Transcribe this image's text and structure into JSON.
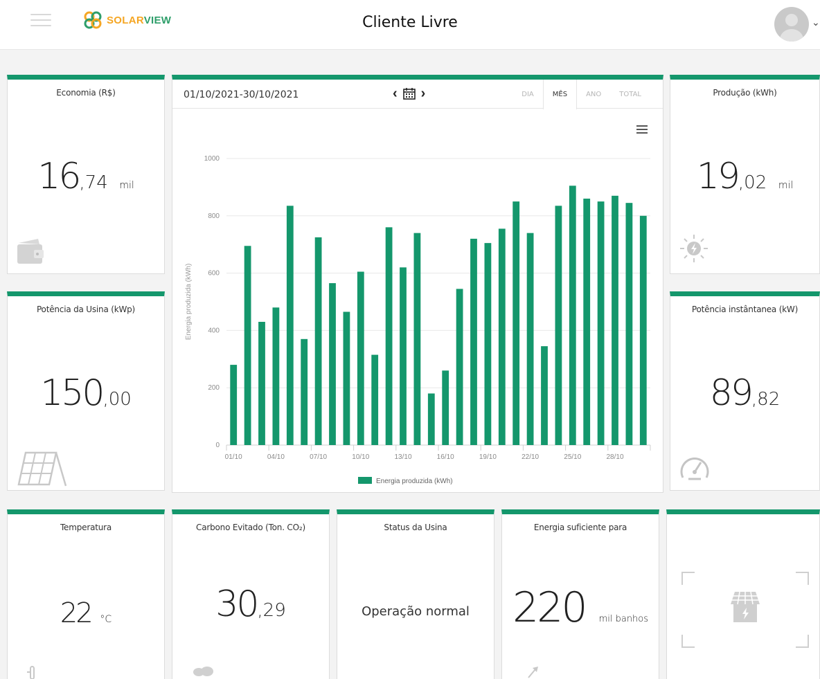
{
  "header": {
    "brand_solar": "SOLAR",
    "brand_view": "VIEW",
    "title": "Cliente Livre"
  },
  "cards": {
    "economia": {
      "title": "Economia (R$)",
      "integer": "16",
      "decimal": ",74",
      "unit": "mil",
      "icon": "wallet-icon"
    },
    "potencia_usina": {
      "title": "Potência da Usina (kWp)",
      "integer": "150",
      "decimal": ",00",
      "unit": "",
      "icon": "solar-panel-icon"
    },
    "producao": {
      "title": "Produção (kWh)",
      "integer": "19",
      "decimal": ",02",
      "unit": "mil",
      "icon": "sun-bolt-icon"
    },
    "potencia_instantanea": {
      "title": "Potência instântanea (kW)",
      "integer": "89",
      "decimal": ",82",
      "unit": "",
      "icon": "gauge-icon"
    },
    "temperatura": {
      "title": "Temperatura",
      "integer": "22",
      "decimal": "",
      "unit": "°C",
      "icon": "thermometer-icon"
    },
    "carbono": {
      "title": "Carbono Evitado (Ton. CO₂)",
      "integer": "30",
      "decimal": ",29",
      "unit": "",
      "icon": "tree-icon"
    },
    "status": {
      "title": "Status da Usina",
      "value": "Operação normal"
    },
    "energia": {
      "title": "Energia suficiente para",
      "integer": "220",
      "decimal": "",
      "unit": "mil banhos",
      "icon": "shower-icon"
    },
    "plant": {
      "icon": "solar-house-icon"
    }
  },
  "chart_panel": {
    "date_range": "01/10/2021-30/10/2021",
    "tabs": [
      "DIA",
      "MÊS",
      "ANO",
      "TOTAL"
    ],
    "active_tab": "MÊS"
  },
  "chart_data": {
    "type": "bar",
    "categories": [
      "01/10",
      "02/10",
      "03/10",
      "04/10",
      "05/10",
      "06/10",
      "07/10",
      "08/10",
      "09/10",
      "10/10",
      "11/10",
      "12/10",
      "13/10",
      "14/10",
      "15/10",
      "16/10",
      "17/10",
      "18/10",
      "19/10",
      "20/10",
      "21/10",
      "22/10",
      "23/10",
      "24/10",
      "25/10",
      "26/10",
      "27/10",
      "28/10",
      "29/10",
      "30/10"
    ],
    "tick_labels": [
      "01/10",
      "04/10",
      "07/10",
      "10/10",
      "13/10",
      "16/10",
      "19/10",
      "22/10",
      "25/10",
      "28/10"
    ],
    "series": [
      {
        "name": "Energia produzida (kWh)",
        "values": [
          280,
          695,
          430,
          480,
          835,
          370,
          725,
          565,
          465,
          605,
          315,
          760,
          620,
          740,
          180,
          260,
          545,
          720,
          705,
          755,
          850,
          740,
          345,
          835,
          905,
          860,
          850,
          870,
          845,
          800
        ]
      }
    ],
    "ylabel": "Energia produzida (kWh)",
    "yticks": [
      0,
      200,
      400,
      600,
      800,
      1000
    ],
    "ylim": [
      0,
      1000
    ],
    "grid": true,
    "legend_position": "bottom-center",
    "color": "#14976c"
  },
  "colors": {
    "accent": "#14976c",
    "brand_orange": "#f5a623"
  }
}
